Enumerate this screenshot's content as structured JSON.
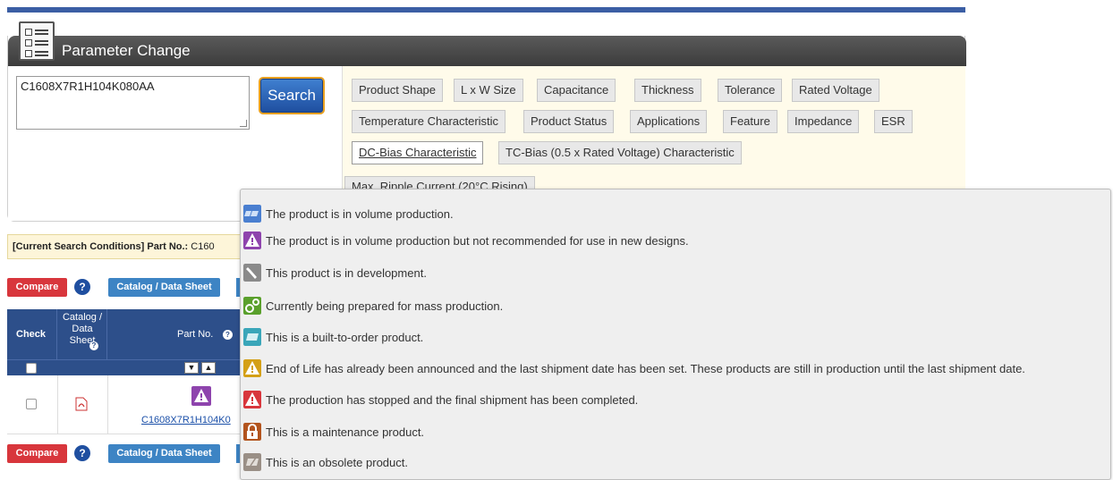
{
  "panel": {
    "title": "Parameter Change",
    "search_value": "C1608X7R1H104K080AA",
    "search_button": "Search",
    "filters_row1": [
      "Product Shape",
      "L x W Size",
      "Capacitance",
      "Thickness",
      "Tolerance",
      "Rated Voltage"
    ],
    "filters_row2": [
      "Temperature Characteristic",
      "Product Status",
      "Applications",
      "Feature",
      "Impedance",
      "ESR"
    ],
    "filters_row3": [
      "DC-Bias Characteristic",
      "TC-Bias (0.5 x Rated Voltage) Characteristic"
    ],
    "filter_row4_partial": "Max. Ripple Current (20°C Rising)"
  },
  "conditions": {
    "label": "[Current Search Conditions]",
    "part_label": "Part No.:",
    "part_value": "C160"
  },
  "toolbar": {
    "compare": "Compare",
    "help": "?",
    "catalog": "Catalog / Data Sheet"
  },
  "table": {
    "headers": {
      "check": "Check",
      "catalog": "Catalog / Data Sheet",
      "part_no": "Part No."
    },
    "row": {
      "part_no": "C1608X7R1H104K0"
    }
  },
  "tooltip": {
    "items": [
      {
        "icon": "volume-production-icon",
        "color": "#4a7fd0",
        "text": "The product is in volume production."
      },
      {
        "icon": "not-recommended-icon",
        "color": "#8e44ad",
        "text": "The product is in volume production but not recommended for use in new designs."
      },
      {
        "icon": "wrench-icon",
        "color": "#8a8a8a",
        "text": "This product is in development."
      },
      {
        "icon": "gears-icon",
        "color": "#5aa02c",
        "text": "Currently being prepared for mass production."
      },
      {
        "icon": "built-to-order-icon",
        "color": "#3aa6b9",
        "text": "This is a built-to-order product."
      },
      {
        "icon": "end-of-life-icon",
        "color": "#d4a017",
        "text": "End of Life has already been announced and the last shipment date has been set. These products are still in production until the last shipment date."
      },
      {
        "icon": "discontinued-icon",
        "color": "#d8363c",
        "text": "The production has stopped and the final shipment has been completed."
      },
      {
        "icon": "maintenance-lock-icon",
        "color": "#b3541e",
        "text": "This is a maintenance product."
      },
      {
        "icon": "obsolete-icon",
        "color": "#9a8f86",
        "text": "This is an obsolete product."
      }
    ]
  }
}
